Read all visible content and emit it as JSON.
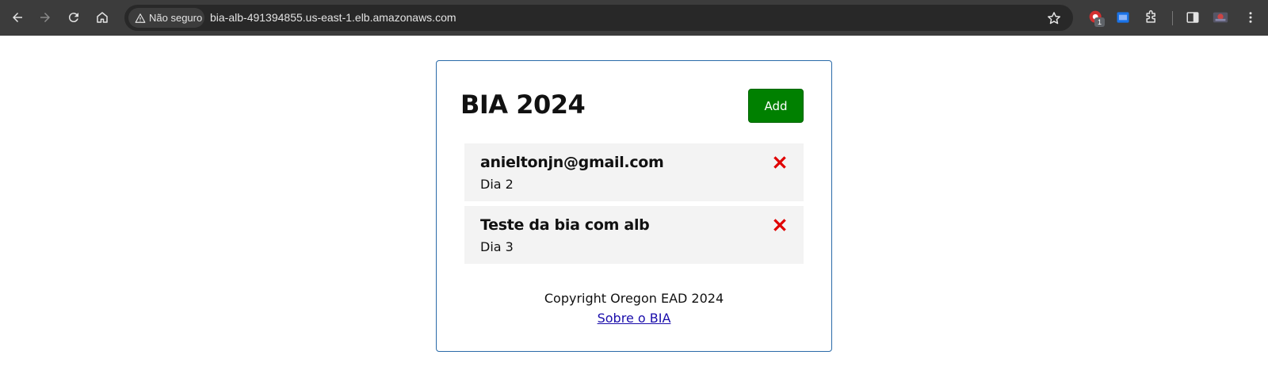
{
  "browser": {
    "security_label": "Não seguro",
    "url": "bia-alb-491394855.us-east-1.elb.amazonaws.com",
    "extension_badge": "1"
  },
  "page": {
    "title": "BIA 2024",
    "add_label": "Add",
    "tasks": [
      {
        "title": "anieltonjn@gmail.com",
        "day": "Dia 2"
      },
      {
        "title": "Teste da bia com alb",
        "day": "Dia 3"
      }
    ],
    "footer_text": "Copyright Oregon EAD 2024",
    "footer_link": "Sobre o BIA"
  },
  "colors": {
    "chrome": "#3c3c3c",
    "omnibox": "#282828",
    "add_button": "#008000",
    "delete": "#e00000",
    "card_border": "#2a6aa8",
    "task_bg": "#f3f3f3"
  },
  "icons": [
    "back-arrow-icon",
    "forward-arrow-icon",
    "reload-icon",
    "home-icon",
    "warning-icon",
    "star-icon",
    "extension-icon",
    "puzzle-icon",
    "side-panel-icon",
    "profile-icon",
    "menu-icon",
    "delete-x-icon"
  ]
}
